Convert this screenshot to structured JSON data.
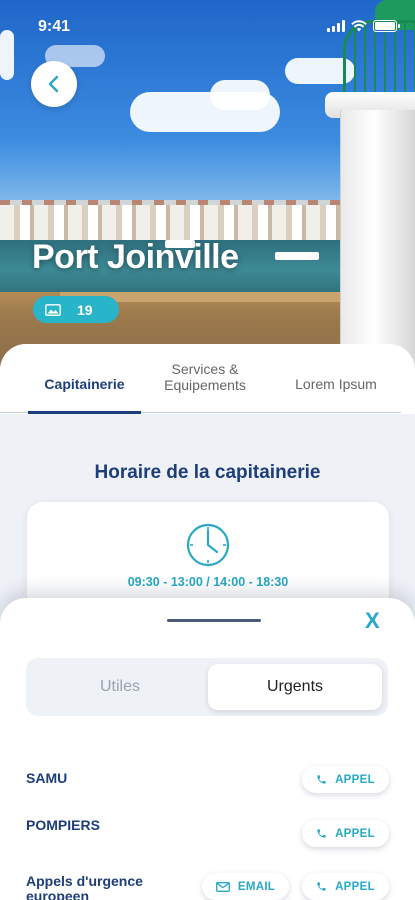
{
  "status_bar": {
    "time": "9:41"
  },
  "hero": {
    "title": "Port Joinville",
    "photo_count": "19"
  },
  "tabs": [
    {
      "label": "Capitainerie",
      "active": true
    },
    {
      "label": "Services &\nEquipements",
      "active": false
    },
    {
      "label": "Lorem Ipsum",
      "active": false
    }
  ],
  "hours_section": {
    "title": "Horaire de la capitainerie",
    "hours": "09:30 - 13:00 / 14:00 - 18:30"
  },
  "sheet": {
    "close_label": "X",
    "segments": [
      {
        "label": "Utiles",
        "active": false
      },
      {
        "label": "Urgents",
        "active": true
      }
    ],
    "contacts": [
      {
        "name": "SAMU",
        "call_label": "APPEL"
      },
      {
        "name": "POMPIERS",
        "call_label": "APPEL"
      },
      {
        "name": "Appels d'urgence europeen",
        "email_label": "EMAIL",
        "call_label": "APPEL"
      }
    ]
  },
  "colors": {
    "navy": "#1d3e7a",
    "teal": "#28a8c4",
    "badge": "#28b4c9"
  },
  "icons": [
    "back-chevron-icon",
    "image-icon",
    "clock-icon",
    "phone-icon",
    "mail-icon",
    "signal-icon",
    "wifi-icon",
    "battery-icon"
  ]
}
